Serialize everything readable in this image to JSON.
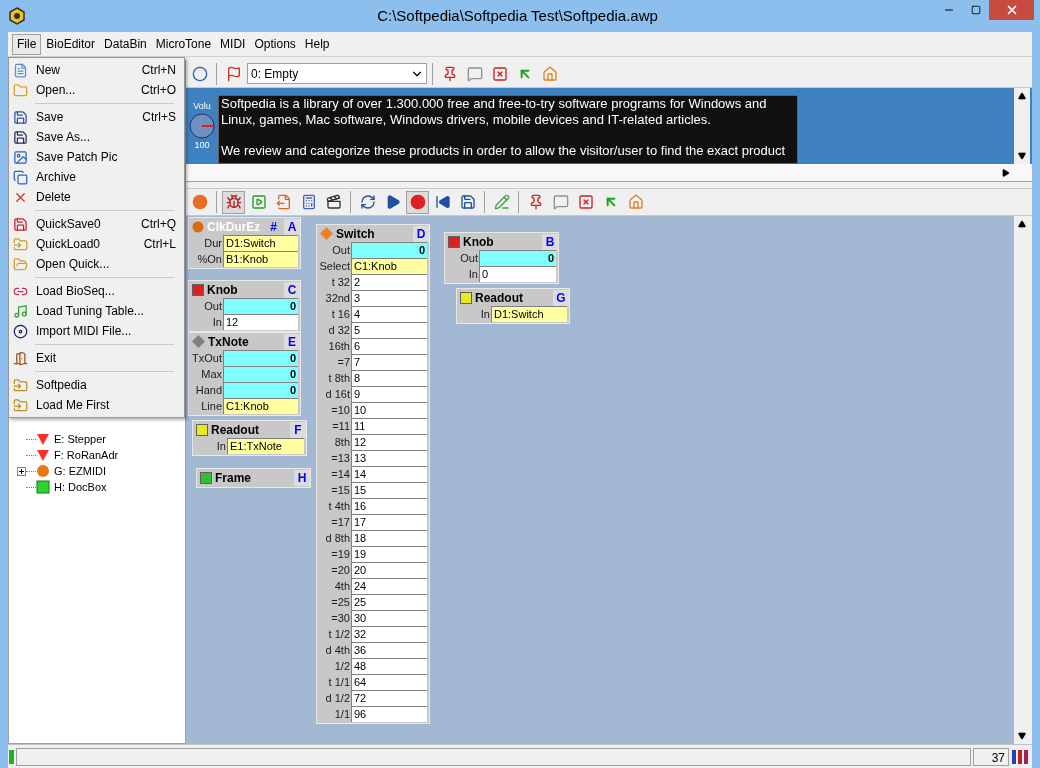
{
  "window": {
    "title": "C:\\Softpedia\\Softpedia Test\\Softpedia.awp"
  },
  "menu_bar": [
    {
      "label": "File",
      "selected": true
    },
    {
      "label": "BioEditor",
      "selected": false
    },
    {
      "label": "DataBin",
      "selected": false
    },
    {
      "label": "MicroTone",
      "selected": false
    },
    {
      "label": "MIDI",
      "selected": false
    },
    {
      "label": "Options",
      "selected": false
    },
    {
      "label": "Help",
      "selected": false
    }
  ],
  "file_menu": [
    [
      {
        "label": "New",
        "shortcut": "Ctrl+N"
      },
      {
        "label": "Open...",
        "shortcut": "Ctrl+O"
      }
    ],
    [
      {
        "label": "Save",
        "shortcut": "Ctrl+S"
      },
      {
        "label": "Save As..."
      },
      {
        "label": "Save Patch Pic"
      },
      {
        "label": "Archive"
      },
      {
        "label": "Delete"
      }
    ],
    [
      {
        "label": "QuickSave0",
        "shortcut": "Ctrl+Q"
      },
      {
        "label": "QuickLoad0",
        "shortcut": "Ctrl+L"
      },
      {
        "label": "Open Quick..."
      }
    ],
    [
      {
        "label": "Load BioSeq..."
      },
      {
        "label": "Load Tuning Table..."
      },
      {
        "label": "Import MIDI File..."
      }
    ],
    [
      {
        "label": "Exit"
      }
    ],
    [
      {
        "label": "Softpedia"
      },
      {
        "label": "Load Me First"
      }
    ]
  ],
  "tree": [
    {
      "label": "E: Stepper",
      "expander": false
    },
    {
      "label": "F: RoRanAdr",
      "expander": false
    },
    {
      "label": "G: EZMIDI",
      "expander": true
    },
    {
      "label": "H: DocBox",
      "expander": false
    }
  ],
  "top_toolbar": {
    "patch": "0: Empty"
  },
  "info_panel": {
    "knob": {
      "label": "Volu",
      "value": "100"
    },
    "paragraphs": [
      "Softpedia is a library of over 1.300.000 free and free-to-try software programs for Windows and Linux, games, Mac software, Windows drivers, mobile devices and IT-related articles.",
      "We review and categorize these products in order to allow the visitor/user to find the exact product"
    ]
  },
  "edit_toolbar": {
    "debug_on": true,
    "record_on": true
  },
  "modules": [
    {
      "letter": "A",
      "title": "ClkDurEz",
      "hash": "#",
      "dimmed": true,
      "rows": [
        {
          "label": "Dur",
          "value": "D1:Switch",
          "kind": "link"
        },
        {
          "label": "%On",
          "value": "B1:Knob",
          "kind": "link"
        }
      ]
    },
    {
      "letter": "C",
      "title": "Knob",
      "dimmed": false,
      "rows": [
        {
          "label": "Out",
          "value": "0",
          "kind": "output"
        },
        {
          "label": "In",
          "value": "12",
          "kind": "value"
        }
      ]
    },
    {
      "letter": "E",
      "title": "TxNote",
      "dimmed": false,
      "rows": [
        {
          "label": "TxOut",
          "value": "0",
          "kind": "output"
        },
        {
          "label": "Max",
          "value": "0",
          "kind": "output"
        },
        {
          "label": "Hand",
          "value": "0",
          "kind": "output"
        },
        {
          "label": "Line",
          "value": "C1:Knob",
          "kind": "link"
        }
      ]
    },
    {
      "letter": "F",
      "title": "Readout",
      "dimmed": false,
      "rows": [
        {
          "label": "In",
          "value": "E1:TxNote",
          "kind": "link"
        }
      ]
    },
    {
      "letter": "H",
      "title": "Frame",
      "dimmed": false
    },
    {
      "letter": "D",
      "title": "Switch",
      "dimmed": false,
      "rows": [
        {
          "label": "Out",
          "value": "0",
          "kind": "output"
        },
        {
          "label": "Select",
          "value": "C1:Knob",
          "kind": "link"
        },
        {
          "label": "t 32",
          "value": "2",
          "kind": "value"
        },
        {
          "label": "32nd",
          "value": "3",
          "kind": "value"
        },
        {
          "label": "t 16",
          "value": "4",
          "kind": "value"
        },
        {
          "label": "d 32",
          "value": "5",
          "kind": "value"
        },
        {
          "label": "16th",
          "value": "6",
          "kind": "value"
        },
        {
          "label": "=7",
          "value": "7",
          "kind": "value"
        },
        {
          "label": "t 8th",
          "value": "8",
          "kind": "value"
        },
        {
          "label": "d 16t",
          "value": "9",
          "kind": "value"
        },
        {
          "label": "=10",
          "value": "10",
          "kind": "value"
        },
        {
          "label": "=11",
          "value": "11",
          "kind": "value"
        },
        {
          "label": "8th",
          "value": "12",
          "kind": "value"
        },
        {
          "label": "=13",
          "value": "13",
          "kind": "value"
        },
        {
          "label": "=14",
          "value": "14",
          "kind": "value"
        },
        {
          "label": "=15",
          "value": "15",
          "kind": "value"
        },
        {
          "label": "t 4th",
          "value": "16",
          "kind": "value"
        },
        {
          "label": "=17",
          "value": "17",
          "kind": "value"
        },
        {
          "label": "d 8th",
          "value": "18",
          "kind": "value"
        },
        {
          "label": "=19",
          "value": "19",
          "kind": "value"
        },
        {
          "label": "=20",
          "value": "20",
          "kind": "value"
        },
        {
          "label": "4th",
          "value": "24",
          "kind": "value"
        },
        {
          "label": "=25",
          "value": "25",
          "kind": "value"
        },
        {
          "label": "=30",
          "value": "30",
          "kind": "value"
        },
        {
          "label": "t 1/2",
          "value": "32",
          "kind": "value"
        },
        {
          "label": "d 4th",
          "value": "36",
          "kind": "value"
        },
        {
          "label": "1/2",
          "value": "48",
          "kind": "value"
        },
        {
          "label": "t 1/1",
          "value": "64",
          "kind": "value"
        },
        {
          "label": "d 1/2",
          "value": "72",
          "kind": "value"
        },
        {
          "label": "1/1",
          "value": "96",
          "kind": "value"
        }
      ]
    },
    {
      "letter": "B",
      "title": "Knob",
      "dimmed": false,
      "rows": [
        {
          "label": "Out",
          "value": "0",
          "kind": "output"
        },
        {
          "label": "In",
          "value": "0",
          "kind": "value"
        }
      ]
    },
    {
      "letter": "G",
      "title": "Readout",
      "dimmed": false,
      "rows": [
        {
          "label": "In",
          "value": "D1:Switch",
          "kind": "link"
        }
      ]
    }
  ],
  "status_bar": {
    "count": "37"
  }
}
